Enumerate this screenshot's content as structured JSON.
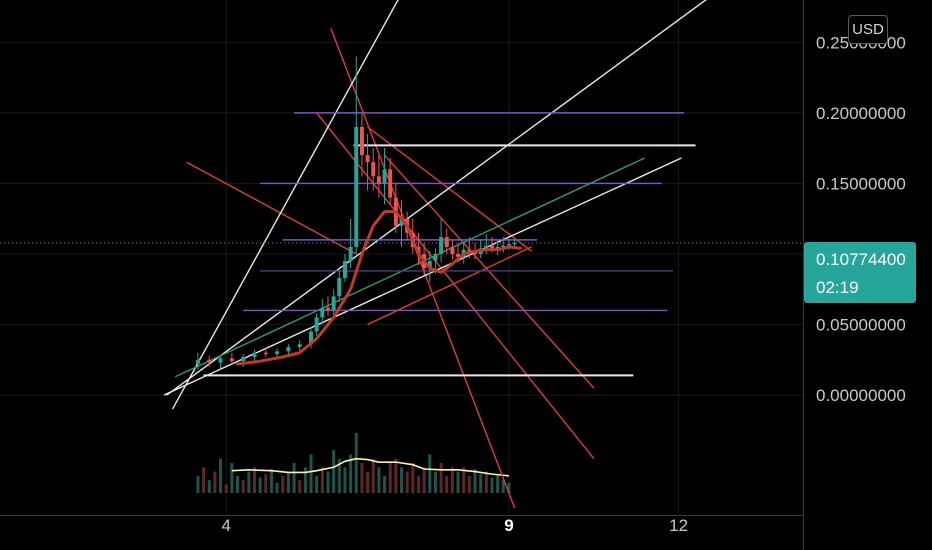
{
  "currency_label": "USD",
  "last_price": {
    "value": 0.107744,
    "label": "0.10774400",
    "countdown": "02:19",
    "color": "#26a69a"
  },
  "colors": {
    "background": "#000000",
    "up": "#26a69a",
    "down": "#ef5350",
    "moving_average": "#c0392b",
    "volume_average": "#fff2a8",
    "trendline_red": "#e53935",
    "trendline_white": "#e8e8e8",
    "trendline_green": "#2e9e5b",
    "level_purple": "#7e57c2",
    "level_dark_purple": "#4a3a8c"
  },
  "chart_data": {
    "type": "candlestick",
    "title": "",
    "xlabel": "",
    "ylabel": "",
    "x_ticks": [
      {
        "label": "4",
        "value": 4,
        "bold": false
      },
      {
        "label": "9",
        "value": 9,
        "bold": true
      },
      {
        "label": "12",
        "value": 12,
        "bold": false
      }
    ],
    "y_ticks": [
      {
        "label": "0.25000000",
        "value": 0.25
      },
      {
        "label": "0.20000000",
        "value": 0.2
      },
      {
        "label": "0.15000000",
        "value": 0.15
      },
      {
        "label": "0.05000000",
        "value": 0.05
      },
      {
        "label": "0.00000000",
        "value": 0.0
      }
    ],
    "xlim": [
      0.0,
      14.2
    ],
    "ylim": [
      -0.085,
      0.28
    ],
    "grid": true,
    "legend": "none",
    "series": [
      {
        "kind": "candles",
        "x": [
          3.5,
          3.7,
          3.9,
          4.1,
          4.3,
          4.5,
          4.7,
          4.9,
          5.1,
          5.3,
          5.5,
          5.6,
          5.7,
          5.8,
          5.9,
          6.0,
          6.1,
          6.2,
          6.3,
          6.4,
          6.5,
          6.6,
          6.7,
          6.8,
          6.9,
          7.0,
          7.1,
          7.2,
          7.3,
          7.4,
          7.5,
          7.6,
          7.7,
          7.8,
          7.9,
          8.0,
          8.1,
          8.2,
          8.3,
          8.4,
          8.5,
          8.6,
          8.7,
          8.8,
          8.9,
          9.0,
          9.1
        ],
        "open": [
          0.022,
          0.025,
          0.023,
          0.026,
          0.024,
          0.027,
          0.03,
          0.029,
          0.031,
          0.034,
          0.036,
          0.045,
          0.055,
          0.062,
          0.06,
          0.07,
          0.083,
          0.095,
          0.105,
          0.19,
          0.17,
          0.165,
          0.155,
          0.15,
          0.16,
          0.14,
          0.12,
          0.125,
          0.115,
          0.105,
          0.1,
          0.09,
          0.095,
          0.1,
          0.112,
          0.105,
          0.1,
          0.098,
          0.103,
          0.101,
          0.1,
          0.104,
          0.106,
          0.103,
          0.105,
          0.106,
          0.107
        ],
        "high": [
          0.03,
          0.028,
          0.028,
          0.03,
          0.029,
          0.032,
          0.034,
          0.033,
          0.036,
          0.039,
          0.048,
          0.058,
          0.068,
          0.07,
          0.075,
          0.088,
          0.1,
          0.125,
          0.24,
          0.2,
          0.185,
          0.175,
          0.17,
          0.175,
          0.168,
          0.15,
          0.138,
          0.13,
          0.125,
          0.115,
          0.108,
          0.102,
          0.104,
          0.125,
          0.118,
          0.11,
          0.108,
          0.108,
          0.112,
          0.108,
          0.11,
          0.114,
          0.112,
          0.11,
          0.112,
          0.111,
          0.11
        ],
        "low": [
          0.018,
          0.02,
          0.019,
          0.022,
          0.02,
          0.024,
          0.027,
          0.026,
          0.028,
          0.031,
          0.033,
          0.042,
          0.05,
          0.056,
          0.057,
          0.066,
          0.08,
          0.09,
          0.1,
          0.155,
          0.145,
          0.145,
          0.14,
          0.135,
          0.135,
          0.115,
          0.105,
          0.11,
          0.1,
          0.092,
          0.085,
          0.08,
          0.086,
          0.094,
          0.1,
          0.096,
          0.094,
          0.093,
          0.097,
          0.096,
          0.097,
          0.1,
          0.101,
          0.099,
          0.101,
          0.103,
          0.104
        ],
        "close": [
          0.025,
          0.023,
          0.026,
          0.024,
          0.027,
          0.03,
          0.029,
          0.031,
          0.034,
          0.036,
          0.045,
          0.055,
          0.062,
          0.06,
          0.07,
          0.083,
          0.095,
          0.105,
          0.19,
          0.17,
          0.165,
          0.155,
          0.15,
          0.16,
          0.14,
          0.12,
          0.125,
          0.115,
          0.105,
          0.1,
          0.09,
          0.095,
          0.1,
          0.112,
          0.105,
          0.1,
          0.098,
          0.103,
          0.101,
          0.1,
          0.104,
          0.106,
          0.103,
          0.105,
          0.106,
          0.107,
          0.1077
        ]
      },
      {
        "kind": "moving-average",
        "x": [
          4.2,
          4.6,
          5.0,
          5.3,
          5.6,
          5.9,
          6.2,
          6.4,
          6.6,
          6.8,
          7.0,
          7.2,
          7.4,
          7.6,
          7.8,
          8.0,
          8.2,
          8.4,
          8.6,
          8.8,
          9.0,
          9.2
        ],
        "y": [
          0.022,
          0.024,
          0.027,
          0.03,
          0.04,
          0.055,
          0.075,
          0.1,
          0.12,
          0.13,
          0.13,
          0.12,
          0.1,
          0.09,
          0.087,
          0.093,
          0.1,
          0.102,
          0.103,
          0.103,
          0.105,
          0.104
        ]
      },
      {
        "kind": "volume",
        "x": [
          3.5,
          3.6,
          3.7,
          3.8,
          3.9,
          4.0,
          4.1,
          4.2,
          4.3,
          4.4,
          4.5,
          4.6,
          4.7,
          4.8,
          4.9,
          5.0,
          5.1,
          5.2,
          5.3,
          5.4,
          5.5,
          5.6,
          5.7,
          5.8,
          5.9,
          6.0,
          6.1,
          6.2,
          6.3,
          6.4,
          6.5,
          6.6,
          6.7,
          6.8,
          6.9,
          7.0,
          7.1,
          7.2,
          7.3,
          7.4,
          7.5,
          7.6,
          7.7,
          7.8,
          7.9,
          8.0,
          8.1,
          8.2,
          8.3,
          8.4,
          8.5,
          8.6,
          8.7,
          8.8,
          8.9,
          9.0
        ],
        "volume": [
          20,
          30,
          15,
          25,
          40,
          10,
          35,
          20,
          15,
          25,
          30,
          18,
          22,
          28,
          12,
          20,
          25,
          35,
          15,
          30,
          45,
          20,
          30,
          25,
          50,
          40,
          30,
          45,
          70,
          35,
          25,
          40,
          30,
          20,
          35,
          40,
          30,
          25,
          35,
          20,
          30,
          45,
          25,
          35,
          20,
          30,
          25,
          30,
          20,
          28,
          22,
          25,
          18,
          20,
          15,
          12
        ],
        "up": [
          1,
          0,
          1,
          0,
          1,
          0,
          1,
          1,
          0,
          1,
          0,
          1,
          0,
          1,
          1,
          0,
          1,
          1,
          0,
          1,
          1,
          1,
          0,
          1,
          1,
          1,
          1,
          1,
          1,
          0,
          0,
          0,
          1,
          1,
          0,
          0,
          1,
          0,
          0,
          0,
          0,
          1,
          1,
          0,
          0,
          0,
          1,
          0,
          0,
          1,
          1,
          0,
          1,
          1,
          1,
          1
        ]
      },
      {
        "kind": "volume-average",
        "x": [
          4.1,
          4.4,
          4.8,
          5.1,
          5.4,
          5.6,
          5.9,
          6.1,
          6.3,
          6.5,
          6.7,
          7.0,
          7.3,
          7.5,
          7.8,
          8.1,
          8.4,
          8.7,
          9.0
        ],
        "volume": [
          26,
          27,
          26,
          24,
          24,
          26,
          30,
          37,
          40,
          39,
          36,
          36,
          33,
          28,
          27,
          27,
          25,
          22,
          20
        ]
      }
    ],
    "drawings": [
      {
        "kind": "ray",
        "color": "red",
        "x1": 5.85,
        "y1": 0.26,
        "x2": 9.1,
        "y2": -0.08
      },
      {
        "kind": "ray",
        "color": "red",
        "x1": 5.6,
        "y1": 0.2,
        "x2": 10.5,
        "y2": -0.045
      },
      {
        "kind": "ray",
        "color": "red",
        "x1": 6.8,
        "y1": 0.17,
        "x2": 10.5,
        "y2": 0.005
      },
      {
        "kind": "ray",
        "color": "red",
        "x1": 3.3,
        "y1": 0.165,
        "x2": 6.3,
        "y2": 0.1
      },
      {
        "kind": "ray",
        "color": "red",
        "x1": 6.5,
        "y1": 0.19,
        "x2": 9.4,
        "y2": 0.102
      },
      {
        "kind": "ray",
        "color": "red",
        "x1": 6.5,
        "y1": 0.05,
        "x2": 9.4,
        "y2": 0.105
      },
      {
        "kind": "ray",
        "color": "white",
        "x1": 3.05,
        "y1": -0.01,
        "x2": 7.45,
        "y2": 0.31
      },
      {
        "kind": "ray",
        "color": "white",
        "x1": 2.95,
        "y1": 0.0,
        "x2": 13.5,
        "y2": 0.31
      },
      {
        "kind": "ray",
        "color": "white",
        "x1": 2.9,
        "y1": 0.0,
        "x2": 12.05,
        "y2": 0.168
      },
      {
        "kind": "ray",
        "color": "green",
        "x1": 3.1,
        "y1": 0.013,
        "x2": 11.4,
        "y2": 0.168
      },
      {
        "kind": "hline",
        "color": "white",
        "x1": 6.25,
        "x2": 12.3,
        "y": 0.177
      },
      {
        "kind": "hline",
        "color": "white",
        "x1": 3.6,
        "x2": 11.2,
        "y": 0.014
      },
      {
        "kind": "hline",
        "color": "purple",
        "x1": 5.2,
        "x2": 12.1,
        "y": 0.2
      },
      {
        "kind": "hline",
        "color": "purple",
        "x1": 4.6,
        "x2": 11.7,
        "y": 0.15
      },
      {
        "kind": "hline",
        "color": "purple",
        "x1": 5.0,
        "x2": 9.5,
        "y": 0.11
      },
      {
        "kind": "hline",
        "color": "dark-purple",
        "x1": 4.6,
        "x2": 11.9,
        "y": 0.088
      },
      {
        "kind": "hline",
        "color": "purple",
        "x1": 4.3,
        "x2": 11.8,
        "y": 0.06
      }
    ]
  }
}
